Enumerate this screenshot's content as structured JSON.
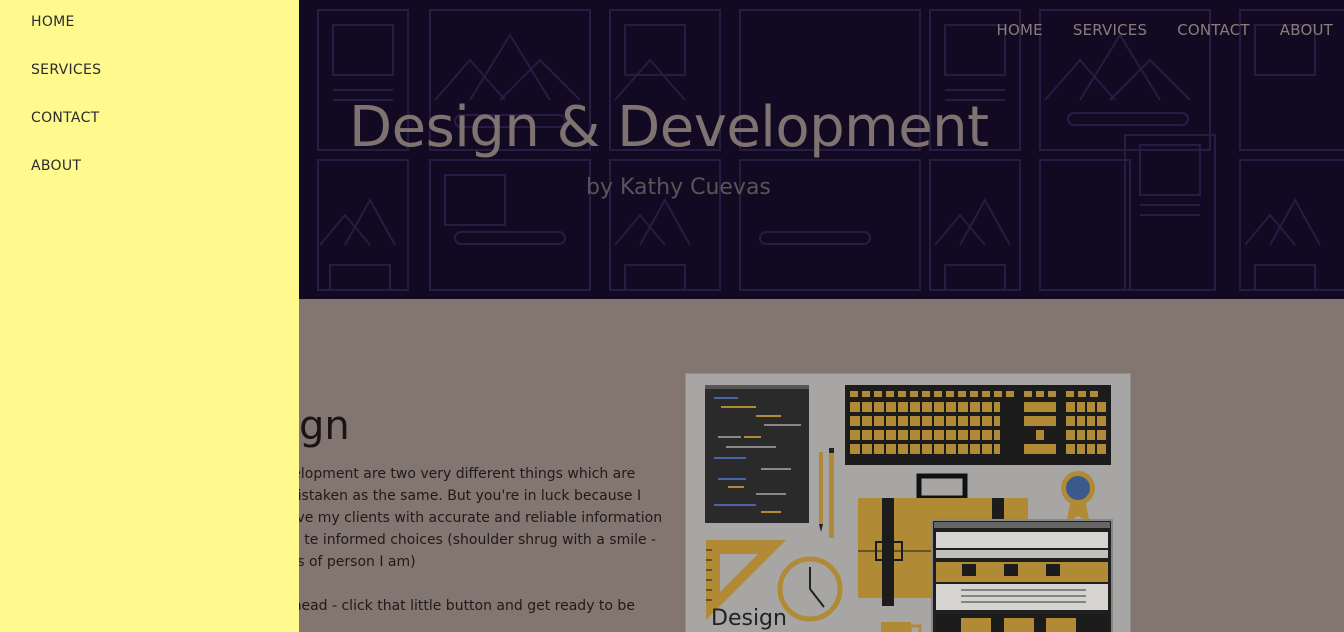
{
  "drawer": {
    "items": [
      {
        "label": "HOME"
      },
      {
        "label": "SERVICES"
      },
      {
        "label": "CONTACT"
      },
      {
        "label": "ABOUT"
      }
    ]
  },
  "header": {
    "nav": [
      {
        "label": "HOME"
      },
      {
        "label": "SERVICES"
      },
      {
        "label": "CONTACT"
      },
      {
        "label": "ABOUT"
      }
    ],
    "title": "Design & Development",
    "subtitle": "by Kathy Cuevas"
  },
  "main": {
    "heading_visible": "gn",
    "paragraph1": "velopment are two very different things which are mistaken as the same. But you're in luck because I love my clients with accurate and reliable information so te informed choices (shoulder shrug with a smile - it's of person I am)",
    "paragraph2": "ahead - click that little button and get ready to be",
    "illustration_caption": "Design"
  },
  "colors": {
    "drawer_bg": "#fff98e",
    "hero_bg": "#120a22",
    "content_bg": "#837570",
    "accent_gold": "#b08a35"
  }
}
